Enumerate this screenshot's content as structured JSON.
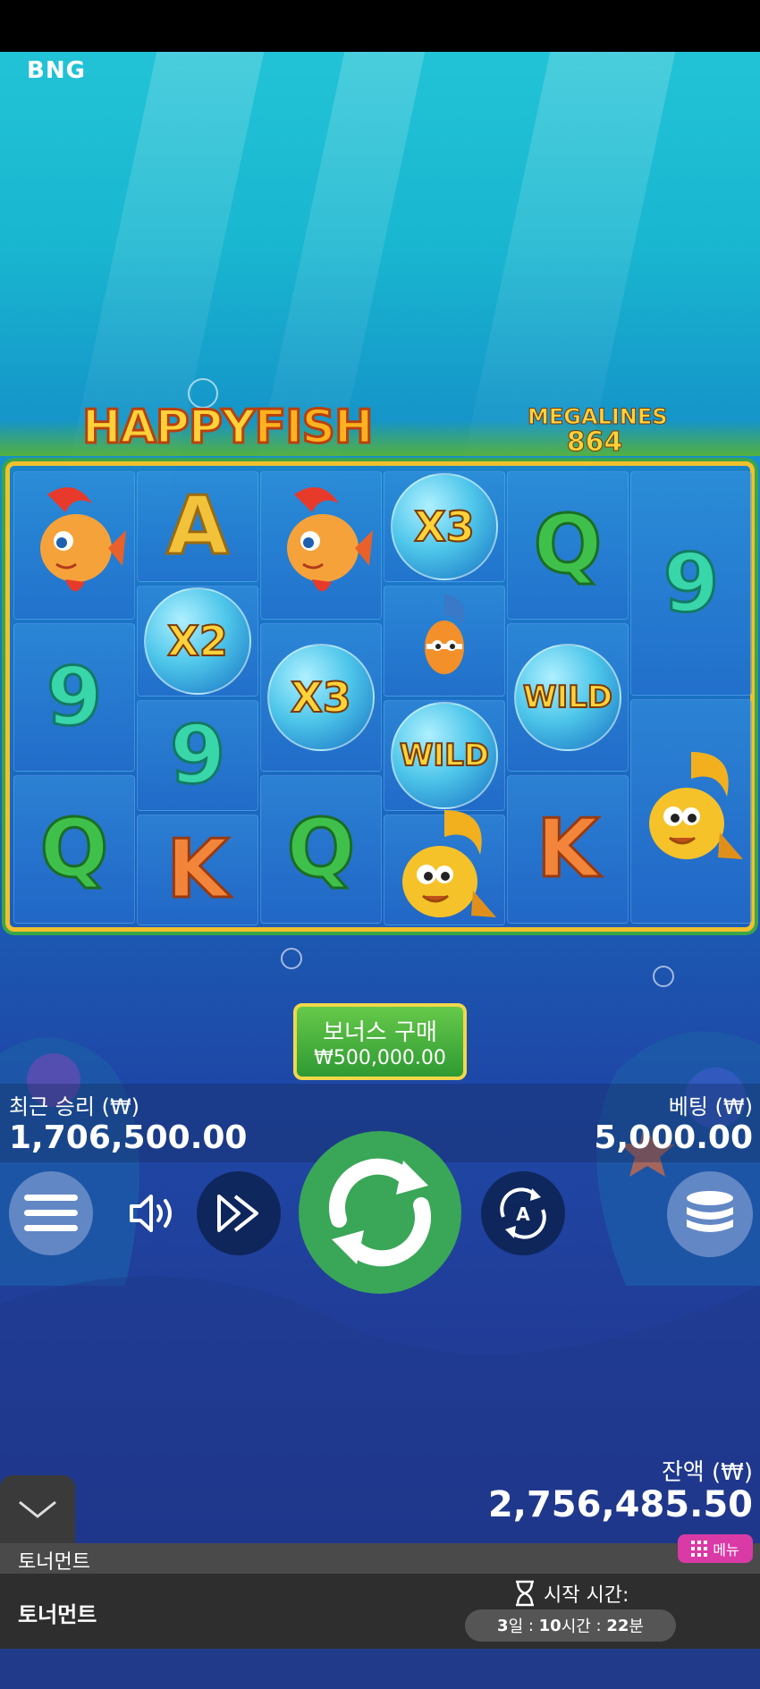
{
  "brand": "BNG",
  "game": {
    "logo_part1": "HAPPY",
    "logo_part2": "FISH",
    "megalines_label": "MEGALINES",
    "megalines_value": "864"
  },
  "reels": [
    [
      {
        "type": "fish",
        "kind": "red-fish",
        "h": 170
      },
      {
        "type": "letter",
        "value": "9",
        "cls": "n9",
        "h": 170
      },
      {
        "type": "letter",
        "value": "Q",
        "cls": "q",
        "h": 170
      }
    ],
    [
      {
        "type": "letter",
        "value": "A",
        "cls": "a",
        "h": 128
      },
      {
        "type": "bubble",
        "value": "X2",
        "h": 128
      },
      {
        "type": "letter",
        "value": "9",
        "cls": "n9",
        "h": 128
      },
      {
        "type": "letter",
        "value": "K",
        "cls": "k",
        "h": 128
      }
    ],
    [
      {
        "type": "fish",
        "kind": "red-fish",
        "h": 170
      },
      {
        "type": "bubble",
        "value": "X3",
        "h": 170
      },
      {
        "type": "letter",
        "value": "Q",
        "cls": "q",
        "h": 170
      }
    ],
    [
      {
        "type": "bubble",
        "value": "X3",
        "h": 128
      },
      {
        "type": "fish",
        "kind": "small-fish",
        "h": 128
      },
      {
        "type": "bubble",
        "value": "WILD",
        "h": 128
      },
      {
        "type": "fish",
        "kind": "gold-fish",
        "h": 128
      }
    ],
    [
      {
        "type": "letter",
        "value": "Q",
        "cls": "q",
        "h": 170
      },
      {
        "type": "bubble",
        "value": "WILD",
        "h": 170
      },
      {
        "type": "letter",
        "value": "K",
        "cls": "k",
        "h": 170
      }
    ],
    [
      {
        "type": "letter",
        "value": "9",
        "cls": "n9",
        "h": 255
      },
      {
        "type": "fish",
        "kind": "gold-fish",
        "h": 255
      }
    ]
  ],
  "bonus": {
    "label": "보너스 구매",
    "price": "₩500,000.00"
  },
  "win": {
    "label": "최근 승리 (₩)",
    "value": "1,706,500.00"
  },
  "bet": {
    "label": "베팅 (₩)",
    "value": "5,000.00"
  },
  "balance": {
    "label": "잔액 (₩)",
    "value": "2,756,485.50"
  },
  "tournament": {
    "tab_label": "토너먼트",
    "title": "토너먼트",
    "menu_label": "메뉴",
    "start_label": "시작 시간:",
    "timer": {
      "days": "3",
      "day_unit": "일",
      "hours": "10",
      "hour_unit": "시간",
      "minutes": "22",
      "minute_unit": "분",
      "sep": " : "
    }
  },
  "colors": {
    "spin": "#3aa657",
    "frame": "#f2c02c",
    "menu_pill": "#d93aa6"
  },
  "icons": [
    "hamburger-menu-icon",
    "speaker-icon",
    "fast-forward-icon",
    "spin-icon",
    "autoplay-icon",
    "coins-icon",
    "chevron-down-icon",
    "grid-menu-icon",
    "hourglass-icon"
  ]
}
